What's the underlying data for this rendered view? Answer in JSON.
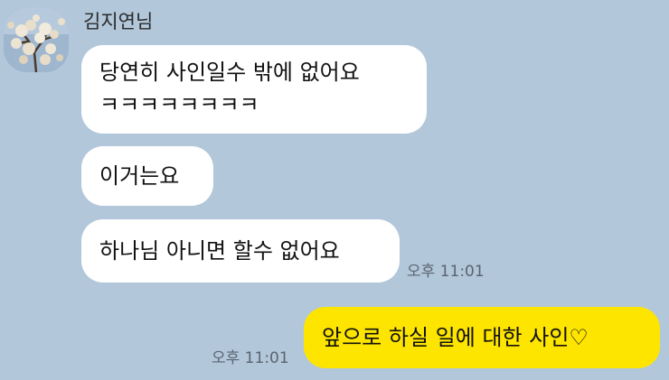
{
  "chat": {
    "sender_name": "김지연님",
    "avatar_icon": "profile-photo-icon",
    "messages": [
      {
        "direction": "incoming",
        "lines": [
          "당연히 사인일수 밖에 없어요",
          "ㅋㅋㅋㅋㅋㅋㅋㅋ"
        ]
      },
      {
        "direction": "incoming",
        "text": "이거는요"
      },
      {
        "direction": "incoming",
        "text": "하나님 아니면 할수 없어요",
        "time": "오후 11:01"
      },
      {
        "direction": "outgoing",
        "text": "앞으로 하실 일에 대한 사인♡",
        "time": "오후 11:01"
      }
    ]
  },
  "colors": {
    "background": "#b2c7da",
    "incoming_bubble": "#ffffff",
    "outgoing_bubble": "#fee500",
    "time_text": "#5b6471"
  }
}
